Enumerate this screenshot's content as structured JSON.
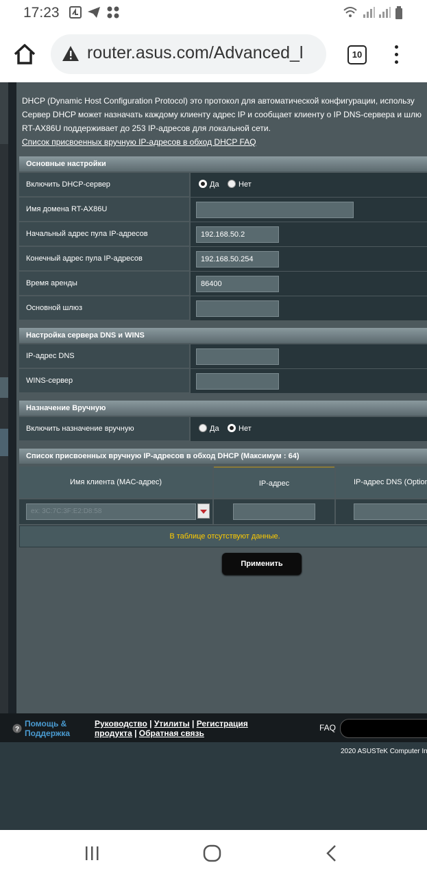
{
  "status_bar": {
    "time": "17:23"
  },
  "browser": {
    "url": "router.asus.com/Advanced_l",
    "tab_count": "10"
  },
  "description": {
    "line1": "DHCP (Dynamic Host Configuration Protocol) это протокол для автоматической конфигурации, использу",
    "line2": "Сервер DHCP может назначать каждому клиенту адрес IP и сообщает клиенту о IP DNS-сервера и шлю",
    "line3": "RT-AX86U поддерживает до 253 IP-адресов для локальной сети.",
    "faq_link": "Список присвоенных вручную IP-адресов в обход DHCP FAQ"
  },
  "basic": {
    "header": "Основные настройки",
    "enable_dhcp_label": "Включить DHCP-сервер",
    "yes": "Да",
    "no": "Нет",
    "domain_label": "Имя домена RT-AX86U",
    "domain_value": "",
    "start_label": "Начальный адрес пула IP-адресов",
    "start_value": "192.168.50.2",
    "end_label": "Конечный адрес пула IP-адресов",
    "end_value": "192.168.50.254",
    "lease_label": "Время аренды",
    "lease_value": "86400",
    "gateway_label": "Основной шлюз",
    "gateway_value": ""
  },
  "dns": {
    "header": "Настройка сервера DNS и WINS",
    "dns_label": "IP-адрес DNS",
    "wins_label": "WINS-сервер"
  },
  "manual": {
    "header": "Назначение Вручную",
    "enable_label": "Включить назначение вручную",
    "yes": "Да",
    "no": "Нет"
  },
  "list": {
    "header": "Список присвоенных вручную IP-адресов в обход DHCP (Максимум : 64)",
    "col_client": "Имя клиента (MAC-адрес)",
    "col_ip": "IP-адрес",
    "col_dns": "IP-адрес DNS (Option",
    "mac_placeholder": "ex: 3C:7C:3F:E2:D8:58",
    "empty": "В таблице отсутствуют данные."
  },
  "apply_label": "Применить",
  "footer": {
    "help1": "Помощь &",
    "help2": "Поддержка",
    "manual": "Руководство",
    "utils": "Утилиты",
    "reg1": "Регистрация",
    "reg2": "продукта",
    "feedback": "Обратная связь",
    "faq": "FAQ",
    "copyright": "2020 ASUSTeK Computer In"
  },
  "colors": {
    "page_bg": "#4d595d",
    "accent_link": "#4a9bd1",
    "empty_text": "#ffcc00"
  }
}
